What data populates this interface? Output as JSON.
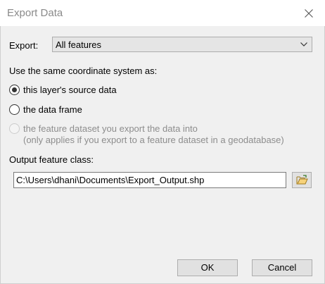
{
  "window": {
    "title": "Export Data",
    "close_icon": "close-icon"
  },
  "export": {
    "label": "Export:",
    "selected": "All features"
  },
  "coordinate_system": {
    "label": "Use the same coordinate system as:",
    "options": [
      {
        "label": "this layer's source data",
        "selected": true,
        "enabled": true
      },
      {
        "label": "the data frame",
        "selected": false,
        "enabled": true
      },
      {
        "label": "the feature dataset you export the data into",
        "note": "(only applies if you export to a feature dataset in a geodatabase)",
        "selected": false,
        "enabled": false
      }
    ]
  },
  "output": {
    "label": "Output feature class:",
    "path": "C:\\Users\\dhani\\Documents\\Export_Output.shp",
    "browse_icon": "folder-open-icon"
  },
  "buttons": {
    "ok": "OK",
    "cancel": "Cancel"
  }
}
